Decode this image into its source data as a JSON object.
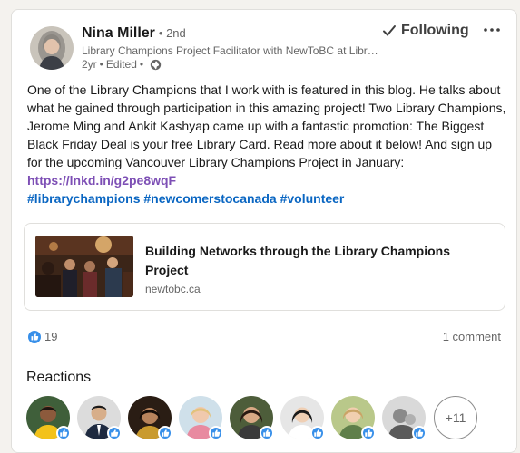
{
  "author": {
    "name": "Nina Miller",
    "connection": "• 2nd",
    "headline": "Library Champions Project Facilitator with NewToBC at Library...",
    "age": "2yr",
    "edited": "Edited",
    "visibility_icon": "globe-icon"
  },
  "actions": {
    "follow_label": "Following",
    "more_icon": "more-options-icon"
  },
  "post": {
    "text": "One of the Library Champions that I work with is featured in this blog. He talks about what he gained through participation in this amazing project! Two Library Champions, Jerome Ming and Ankit Kashyap came up with a fantastic promotion: The Biggest Black Friday Deal is your free Library Card. Read more about it below! And sign up for the upcoming Vancouver Library Champions Project in January:",
    "link": "https://lnkd.in/g2pe8wqF",
    "hashtags": [
      "#librarychampions",
      "#newcomerstocanada",
      "#volunteer"
    ]
  },
  "preview": {
    "title": "Building Networks through the Library Champions Project",
    "domain": "newtobc.ca"
  },
  "social": {
    "reaction_count": "19",
    "comments": "1 comment"
  },
  "reactions": {
    "title": "Reactions",
    "more": "+11"
  },
  "colors": {
    "link_blue": "#0a66c2",
    "visited_link": "#7d4fb5",
    "like_blue": "#378fe9"
  }
}
